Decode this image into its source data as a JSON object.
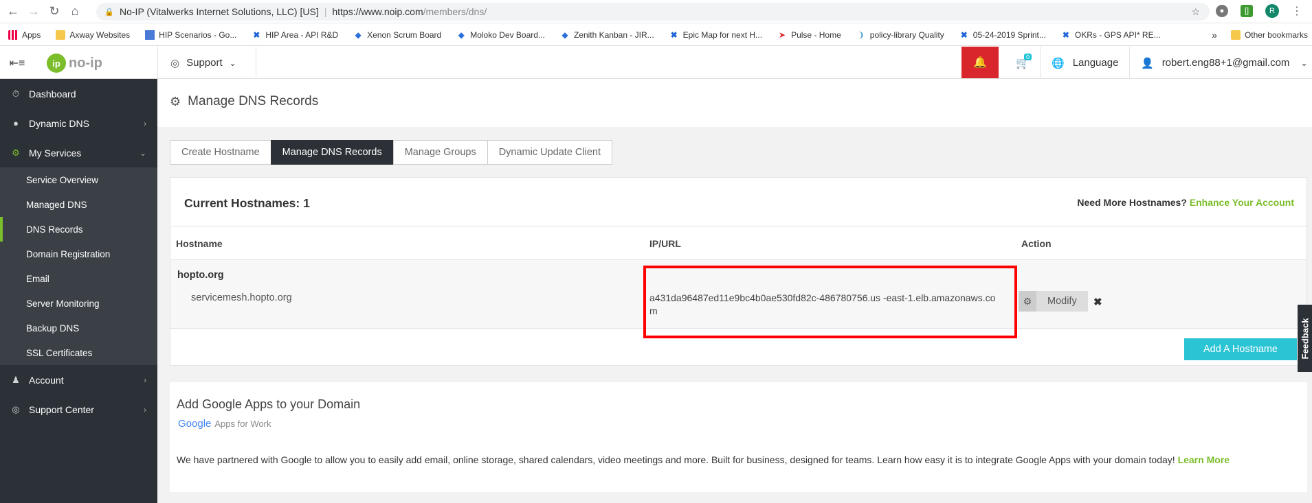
{
  "browser": {
    "tab_title": "No-IP (Vitalwerks Internet Solutions, LLC) [US]",
    "url_host": "https://www.noip.com",
    "url_path": "/members/dns/",
    "profile_initial": "R"
  },
  "bookmarks": {
    "items": [
      {
        "label": "Apps",
        "icon": "apps-grid-icon"
      },
      {
        "label": "Axway Websites",
        "icon": "folder-icon"
      },
      {
        "label": "HIP Scenarios - Go...",
        "icon": "doc-icon"
      },
      {
        "label": "HIP Area - API R&D",
        "icon": "jira-icon"
      },
      {
        "label": "Xenon Scrum Board",
        "icon": "diamond-icon"
      },
      {
        "label": "Moloko Dev Board...",
        "icon": "diamond-icon"
      },
      {
        "label": "Zenith Kanban - JIR...",
        "icon": "diamond-icon"
      },
      {
        "label": "Epic Map for next H...",
        "icon": "jira-icon"
      },
      {
        "label": "Pulse - Home",
        "icon": "pulse-icon"
      },
      {
        "label": "policy-library Quality",
        "icon": "sonar-icon"
      },
      {
        "label": "05-24-2019 Sprint...",
        "icon": "jira-icon"
      },
      {
        "label": "OKRs - GPS API* RE...",
        "icon": "jira-icon"
      }
    ],
    "overflow": "»",
    "other": "Other bookmarks"
  },
  "header": {
    "logo_text": "no-ip",
    "support_label": "Support",
    "cart_count": "0",
    "language_label": "Language",
    "user_email": "robert.eng88+1@gmail.com"
  },
  "sidebar": {
    "items": [
      {
        "label": "Dashboard",
        "icon": "dashboard-icon"
      },
      {
        "label": "Dynamic DNS",
        "icon": "globe-icon"
      },
      {
        "label": "My Services",
        "icon": "gear-icon"
      }
    ],
    "sub_items": [
      {
        "label": "Service Overview"
      },
      {
        "label": "Managed DNS"
      },
      {
        "label": "DNS Records"
      },
      {
        "label": "Domain Registration"
      },
      {
        "label": "Email"
      },
      {
        "label": "Server Monitoring"
      },
      {
        "label": "Backup DNS"
      },
      {
        "label": "SSL Certificates"
      }
    ],
    "bottom_items": [
      {
        "label": "Account",
        "icon": "user-icon"
      },
      {
        "label": "Support Center",
        "icon": "globe-icon"
      }
    ]
  },
  "page": {
    "title": "Manage DNS Records",
    "tabs": [
      {
        "label": "Create Hostname"
      },
      {
        "label": "Manage DNS Records"
      },
      {
        "label": "Manage Groups"
      },
      {
        "label": "Dynamic Update Client"
      }
    ]
  },
  "hostnames": {
    "title": "Current Hostnames: 1",
    "upsell_prefix": "Need More Hostnames?",
    "upsell_link": "Enhance Your Account",
    "columns": [
      "Hostname",
      "IP/URL",
      "Action"
    ],
    "domain": "hopto.org",
    "rows": [
      {
        "hostname": "servicemesh.hopto.org",
        "ip_url": "a431da96487ed11e9bc4b0ae530fd82c-486780756.us -east-1.elb.amazonaws.com",
        "action_label": "Modify"
      }
    ],
    "add_button": "Add A Hostname"
  },
  "google": {
    "title": "Add Google Apps to your Domain",
    "logo_word": "Google",
    "logo_sub": "Apps for Work",
    "text": "We have partnered with Google to allow you to easily add email, online storage, shared calendars, video meetings and more. Built for business, designed for teams. Learn how easy it is to integrate Google Apps with your domain today!",
    "link": "Learn More"
  },
  "feedback_label": "Feedback",
  "colors": {
    "brand_green": "#7bbd2a",
    "sidebar_bg": "#2c3137",
    "alert_red": "#d9262c",
    "accent_teal": "#2bc4d5",
    "highlight": "#ff0000"
  }
}
